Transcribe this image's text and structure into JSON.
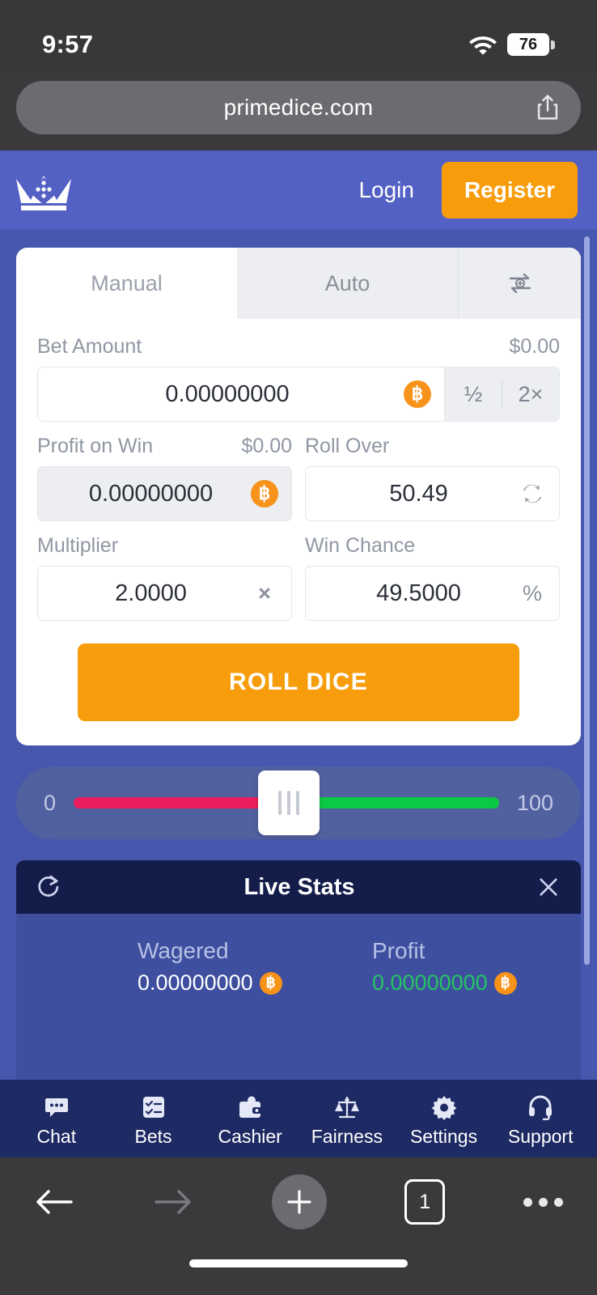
{
  "status_bar": {
    "time": "9:57",
    "battery_percent": "76",
    "wifi_icon": "wifi-icon",
    "battery_icon": "battery-icon"
  },
  "browser": {
    "url": "primedice.com",
    "share_icon": "share-icon",
    "bottom_toolbar": {
      "back_icon": "back-arrow-icon",
      "forward_icon": "forward-arrow-icon",
      "new_tab_icon": "plus-icon",
      "tab_count": "1",
      "menu_icon": "more-options-icon"
    }
  },
  "app_header": {
    "logo_icon": "crown-dice-logo-icon",
    "login_label": "Login",
    "register_label": "Register",
    "accent_color": "#f79d0c",
    "header_bg": "#5360c4"
  },
  "bet_card": {
    "tabs": [
      {
        "label": "Manual",
        "active": true
      },
      {
        "label": "Auto",
        "active": false
      },
      {
        "label": "",
        "icon": "swap-plus-icon",
        "active": false
      }
    ],
    "bet_amount": {
      "label": "Bet Amount",
      "usd": "$0.00",
      "value": "0.00000000",
      "currency_icon": "bitcoin-icon",
      "half_label": "½",
      "double_label": "2×"
    },
    "profit_on_win": {
      "label": "Profit on Win",
      "usd": "$0.00",
      "value": "0.00000000",
      "currency_icon": "bitcoin-icon"
    },
    "roll_over": {
      "label": "Roll Over",
      "value": "50.49",
      "swap_icon": "swap-arrows-icon"
    },
    "multiplier": {
      "label": "Multiplier",
      "value": "2.0000",
      "unit": "×"
    },
    "win_chance": {
      "label": "Win Chance",
      "value": "49.5000",
      "unit": "%"
    },
    "roll_button_label": "ROLL DICE"
  },
  "slider": {
    "min_label": "0",
    "max_label": "100",
    "value": 50.49,
    "lose_color": "#ea1e5c",
    "win_color": "#0ac943",
    "track_bg": "#51609f"
  },
  "live_stats": {
    "title": "Live Stats",
    "refresh_icon": "refresh-icon",
    "close_icon": "close-icon",
    "stats": [
      {
        "label": "Wagered",
        "value": "0.00000000",
        "currency_icon": "bitcoin-icon",
        "color": "#ffffff"
      },
      {
        "label": "Profit",
        "value": "0.00000000",
        "currency_icon": "bitcoin-icon",
        "color": "#25c463"
      }
    ]
  },
  "app_nav": {
    "items": [
      {
        "label": "Chat",
        "icon": "chat-bubble-icon"
      },
      {
        "label": "Bets",
        "icon": "checklist-icon"
      },
      {
        "label": "Cashier",
        "icon": "wallet-icon"
      },
      {
        "label": "Fairness",
        "icon": "scales-icon"
      },
      {
        "label": "Settings",
        "icon": "gear-icon"
      },
      {
        "label": "Support",
        "icon": "headset-icon"
      }
    ]
  }
}
